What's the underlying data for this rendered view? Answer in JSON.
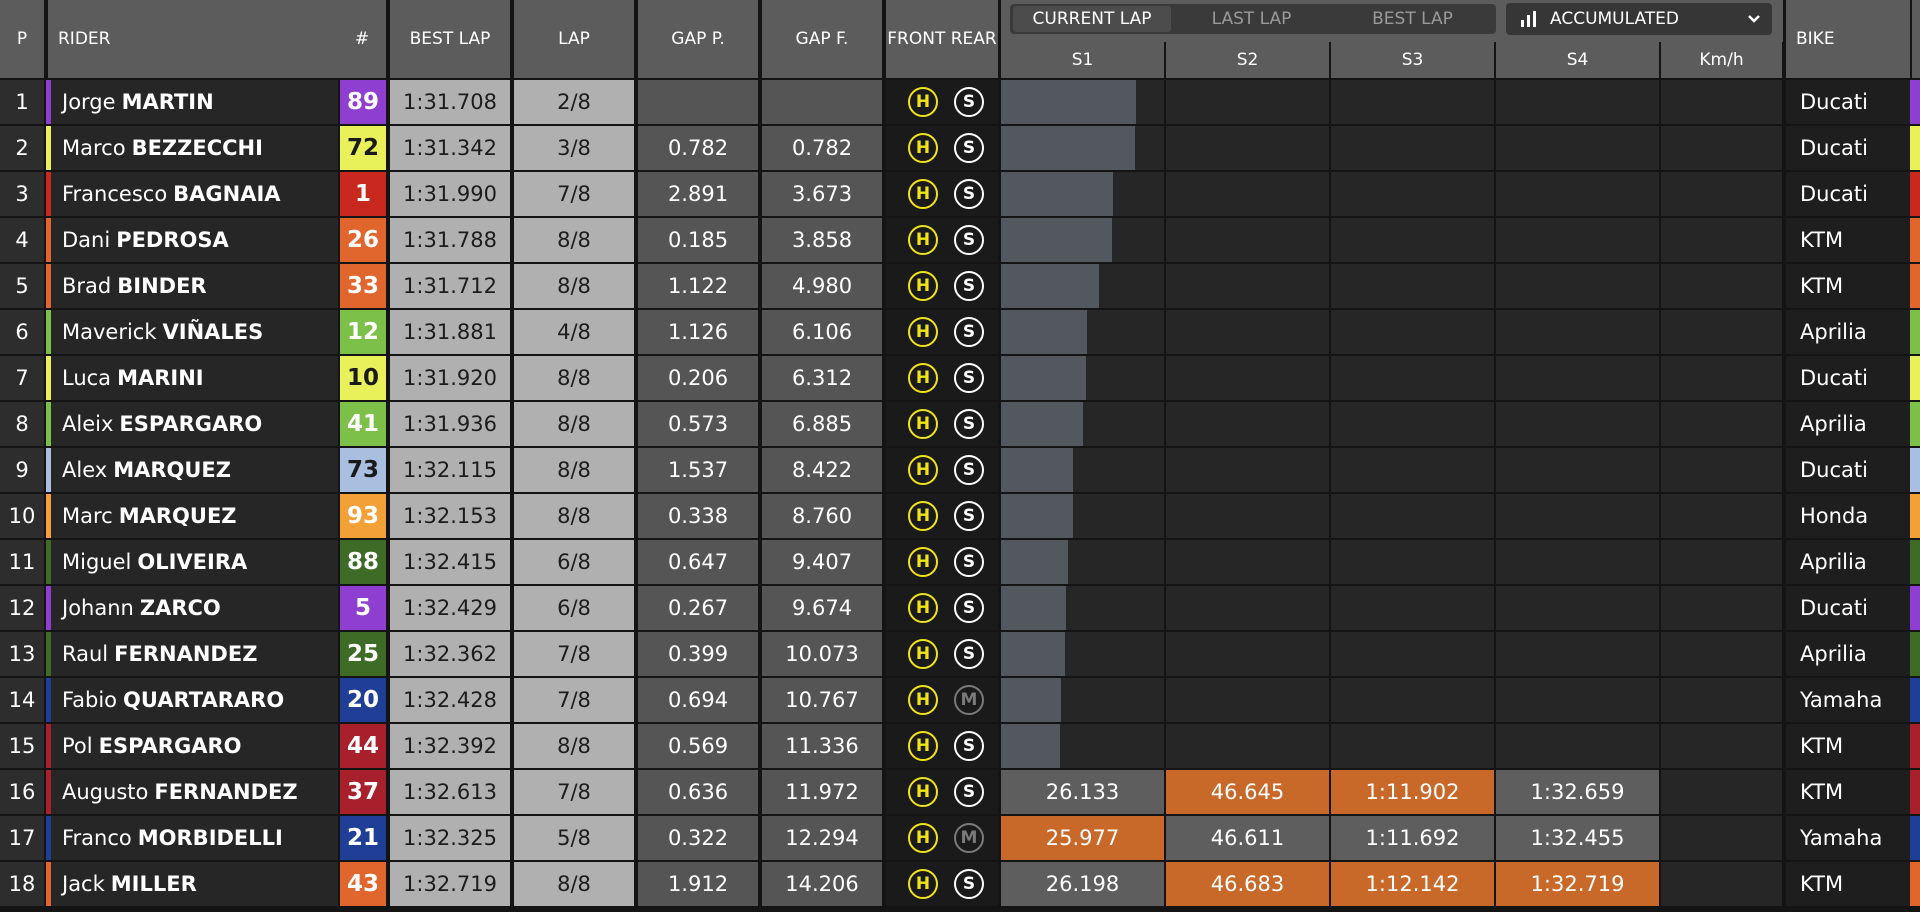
{
  "columns": {
    "pos": "P",
    "rider": "RIDER",
    "number": "#",
    "best_lap": "BEST LAP",
    "lap": "LAP",
    "gap_p": "GAP P.",
    "gap_f": "GAP F.",
    "front": "FRONT",
    "rear": "REAR",
    "s1": "S1",
    "s2": "S2",
    "s3": "S3",
    "s4": "S4",
    "speed": "Km/h",
    "bike": "BIKE"
  },
  "tabs": [
    "CURRENT LAP",
    "LAST LAP",
    "BEST LAP"
  ],
  "active_tab": "CURRENT LAP",
  "view_select": {
    "icon": "bar-chart-icon",
    "label": "ACCUMULATED"
  },
  "colors": {
    "header_bg": "#5c5c5c",
    "best_time_orange": "#c8692a",
    "tyre_hard": "#f0e419",
    "tyre_soft": "#ffffff",
    "tyre_medium_worn": "#7a7a7a",
    "s1_progress_bar": "#53575e"
  },
  "riders": [
    {
      "pos": "1",
      "first": "Jorge",
      "last": "MARTIN",
      "num": "89",
      "num_color": "#8e3fcf",
      "num_text": "#ffffff",
      "best": "1:31.708",
      "lap": "2/8",
      "gap_p": "",
      "gap_f": "",
      "front": "H",
      "rear": "S",
      "s1_progress": 0.83,
      "s1": "",
      "s2": "",
      "s3": "",
      "s4": "",
      "s1_color": "",
      "s2_color": "",
      "s3_color": "",
      "s4_color": "",
      "bike": "Ducati"
    },
    {
      "pos": "2",
      "first": "Marco",
      "last": "BEZZECCHI",
      "num": "72",
      "num_color": "#e8f05a",
      "num_text": "#1a1a1a",
      "best": "1:31.342",
      "lap": "3/8",
      "gap_p": "0.782",
      "gap_f": "0.782",
      "front": "H",
      "rear": "S",
      "s1_progress": 0.82,
      "s1": "",
      "s2": "",
      "s3": "",
      "s4": "",
      "s1_color": "",
      "s2_color": "",
      "s3_color": "",
      "s4_color": "",
      "bike": "Ducati"
    },
    {
      "pos": "3",
      "first": "Francesco",
      "last": "BAGNAIA",
      "num": "1",
      "num_color": "#c8281e",
      "num_text": "#ffffff",
      "best": "1:31.990",
      "lap": "7/8",
      "gap_p": "2.891",
      "gap_f": "3.673",
      "front": "H",
      "rear": "S",
      "s1_progress": 0.69,
      "s1": "",
      "s2": "",
      "s3": "",
      "s4": "",
      "s1_color": "",
      "s2_color": "",
      "s3_color": "",
      "s4_color": "",
      "bike": "Ducati"
    },
    {
      "pos": "4",
      "first": "Dani",
      "last": "PEDROSA",
      "num": "26",
      "num_color": "#e0662e",
      "num_text": "#ffffff",
      "best": "1:31.788",
      "lap": "8/8",
      "gap_p": "0.185",
      "gap_f": "3.858",
      "front": "H",
      "rear": "S",
      "s1_progress": 0.68,
      "s1": "",
      "s2": "",
      "s3": "",
      "s4": "",
      "s1_color": "",
      "s2_color": "",
      "s3_color": "",
      "s4_color": "",
      "bike": "KTM"
    },
    {
      "pos": "5",
      "first": "Brad",
      "last": "BINDER",
      "num": "33",
      "num_color": "#e0662e",
      "num_text": "#ffffff",
      "best": "1:31.712",
      "lap": "8/8",
      "gap_p": "1.122",
      "gap_f": "4.980",
      "front": "H",
      "rear": "S",
      "s1_progress": 0.6,
      "s1": "",
      "s2": "",
      "s3": "",
      "s4": "",
      "s1_color": "",
      "s2_color": "",
      "s3_color": "",
      "s4_color": "",
      "bike": "KTM"
    },
    {
      "pos": "6",
      "first": "Maverick",
      "last": "VIÑALES",
      "num": "12",
      "num_color": "#7cc04a",
      "num_text": "#ffffff",
      "best": "1:31.881",
      "lap": "4/8",
      "gap_p": "1.126",
      "gap_f": "6.106",
      "front": "H",
      "rear": "S",
      "s1_progress": 0.53,
      "s1": "",
      "s2": "",
      "s3": "",
      "s4": "",
      "s1_color": "",
      "s2_color": "",
      "s3_color": "",
      "s4_color": "",
      "bike": "Aprilia"
    },
    {
      "pos": "7",
      "first": "Luca",
      "last": "MARINI",
      "num": "10",
      "num_color": "#e8f05a",
      "num_text": "#1a1a1a",
      "best": "1:31.920",
      "lap": "8/8",
      "gap_p": "0.206",
      "gap_f": "6.312",
      "front": "H",
      "rear": "S",
      "s1_progress": 0.52,
      "s1": "",
      "s2": "",
      "s3": "",
      "s4": "",
      "s1_color": "",
      "s2_color": "",
      "s3_color": "",
      "s4_color": "",
      "bike": "Ducati"
    },
    {
      "pos": "8",
      "first": "Aleix",
      "last": "ESPARGARO",
      "num": "41",
      "num_color": "#7cc04a",
      "num_text": "#ffffff",
      "best": "1:31.936",
      "lap": "8/8",
      "gap_p": "0.573",
      "gap_f": "6.885",
      "front": "H",
      "rear": "S",
      "s1_progress": 0.5,
      "s1": "",
      "s2": "",
      "s3": "",
      "s4": "",
      "s1_color": "",
      "s2_color": "",
      "s3_color": "",
      "s4_color": "",
      "bike": "Aprilia"
    },
    {
      "pos": "9",
      "first": "Alex",
      "last": "MARQUEZ",
      "num": "73",
      "num_color": "#a9bfe0",
      "num_text": "#1a1a1a",
      "best": "1:32.115",
      "lap": "8/8",
      "gap_p": "1.537",
      "gap_f": "8.422",
      "front": "H",
      "rear": "S",
      "s1_progress": 0.44,
      "s1": "",
      "s2": "",
      "s3": "",
      "s4": "",
      "s1_color": "",
      "s2_color": "",
      "s3_color": "",
      "s4_color": "",
      "bike": "Ducati"
    },
    {
      "pos": "10",
      "first": "Marc",
      "last": "MARQUEZ",
      "num": "93",
      "num_color": "#f3a037",
      "num_text": "#ffffff",
      "best": "1:32.153",
      "lap": "8/8",
      "gap_p": "0.338",
      "gap_f": "8.760",
      "front": "H",
      "rear": "S",
      "s1_progress": 0.44,
      "s1": "",
      "s2": "",
      "s3": "",
      "s4": "",
      "s1_color": "",
      "s2_color": "",
      "s3_color": "",
      "s4_color": "",
      "bike": "Honda"
    },
    {
      "pos": "11",
      "first": "Miguel",
      "last": "OLIVEIRA",
      "num": "88",
      "num_color": "#3e6b26",
      "num_text": "#ffffff",
      "best": "1:32.415",
      "lap": "6/8",
      "gap_p": "0.647",
      "gap_f": "9.407",
      "front": "H",
      "rear": "S",
      "s1_progress": 0.41,
      "s1": "",
      "s2": "",
      "s3": "",
      "s4": "",
      "s1_color": "",
      "s2_color": "",
      "s3_color": "",
      "s4_color": "",
      "bike": "Aprilia"
    },
    {
      "pos": "12",
      "first": "Johann",
      "last": "ZARCO",
      "num": "5",
      "num_color": "#8e3fcf",
      "num_text": "#ffffff",
      "best": "1:32.429",
      "lap": "6/8",
      "gap_p": "0.267",
      "gap_f": "9.674",
      "front": "H",
      "rear": "S",
      "s1_progress": 0.4,
      "s1": "",
      "s2": "",
      "s3": "",
      "s4": "",
      "s1_color": "",
      "s2_color": "",
      "s3_color": "",
      "s4_color": "",
      "bike": "Ducati"
    },
    {
      "pos": "13",
      "first": "Raul",
      "last": "FERNANDEZ",
      "num": "25",
      "num_color": "#3e6b26",
      "num_text": "#ffffff",
      "best": "1:32.362",
      "lap": "7/8",
      "gap_p": "0.399",
      "gap_f": "10.073",
      "front": "H",
      "rear": "S",
      "s1_progress": 0.39,
      "s1": "",
      "s2": "",
      "s3": "",
      "s4": "",
      "s1_color": "",
      "s2_color": "",
      "s3_color": "",
      "s4_color": "",
      "bike": "Aprilia"
    },
    {
      "pos": "14",
      "first": "Fabio",
      "last": "QUARTARARO",
      "num": "20",
      "num_color": "#1f3f96",
      "num_text": "#ffffff",
      "best": "1:32.428",
      "lap": "7/8",
      "gap_p": "0.694",
      "gap_f": "10.767",
      "front": "H",
      "rear": "M",
      "s1_progress": 0.37,
      "s1": "",
      "s2": "",
      "s3": "",
      "s4": "",
      "s1_color": "",
      "s2_color": "",
      "s3_color": "",
      "s4_color": "",
      "bike": "Yamaha"
    },
    {
      "pos": "15",
      "first": "Pol",
      "last": "ESPARGARO",
      "num": "44",
      "num_color": "#a8202c",
      "num_text": "#ffffff",
      "best": "1:32.392",
      "lap": "8/8",
      "gap_p": "0.569",
      "gap_f": "11.336",
      "front": "H",
      "rear": "S",
      "s1_progress": 0.36,
      "s1": "",
      "s2": "",
      "s3": "",
      "s4": "",
      "s1_color": "",
      "s2_color": "",
      "s3_color": "",
      "s4_color": "",
      "bike": "KTM"
    },
    {
      "pos": "16",
      "first": "Augusto",
      "last": "FERNANDEZ",
      "num": "37",
      "num_color": "#a8202c",
      "num_text": "#ffffff",
      "best": "1:32.613",
      "lap": "7/8",
      "gap_p": "0.636",
      "gap_f": "11.972",
      "front": "H",
      "rear": "S",
      "s1_progress": 0,
      "s1": "26.133",
      "s2": "46.645",
      "s3": "1:11.902",
      "s4": "1:32.659",
      "s1_color": "#5e5e5e",
      "s2_color": "#c8692a",
      "s3_color": "#c8692a",
      "s4_color": "#5e5e5e",
      "bike": "KTM"
    },
    {
      "pos": "17",
      "first": "Franco",
      "last": "MORBIDELLI",
      "num": "21",
      "num_color": "#1f3f96",
      "num_text": "#ffffff",
      "best": "1:32.325",
      "lap": "5/8",
      "gap_p": "0.322",
      "gap_f": "12.294",
      "front": "H",
      "rear": "M",
      "s1_progress": 0,
      "s1": "25.977",
      "s2": "46.611",
      "s3": "1:11.692",
      "s4": "1:32.455",
      "s1_color": "#c8692a",
      "s2_color": "#5e5e5e",
      "s3_color": "#5e5e5e",
      "s4_color": "#5e5e5e",
      "bike": "Yamaha"
    },
    {
      "pos": "18",
      "first": "Jack",
      "last": "MILLER",
      "num": "43",
      "num_color": "#e0662e",
      "num_text": "#ffffff",
      "best": "1:32.719",
      "lap": "8/8",
      "gap_p": "1.912",
      "gap_f": "14.206",
      "front": "H",
      "rear": "S",
      "s1_progress": 0,
      "s1": "26.198",
      "s2": "46.683",
      "s3": "1:12.142",
      "s4": "1:32.719",
      "s1_color": "#5e5e5e",
      "s2_color": "#c8692a",
      "s3_color": "#c8692a",
      "s4_color": "#c8692a",
      "bike": "KTM"
    }
  ]
}
